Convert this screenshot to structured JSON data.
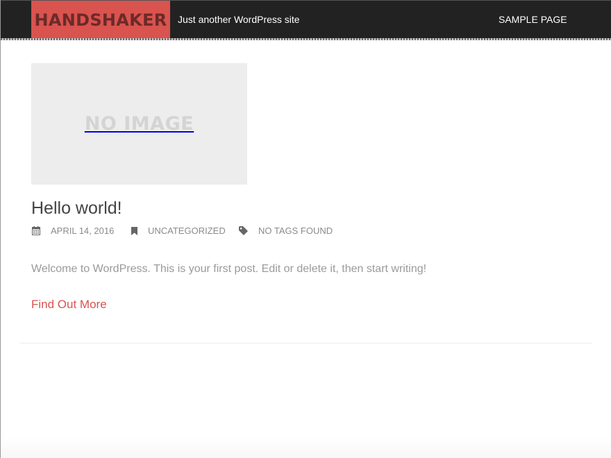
{
  "header": {
    "site_title": "HANDSHAKER",
    "tagline": "Just another WordPress site",
    "nav": [
      {
        "label": "SAMPLE PAGE"
      }
    ]
  },
  "post": {
    "thumbnail_text": "NO IMAGE",
    "title": "Hello world!",
    "meta": {
      "date": "APRIL 14, 2016",
      "category": "UNCATEGORIZED",
      "tags": "NO TAGS FOUND"
    },
    "excerpt": "Welcome to WordPress. This is your first post. Edit or delete it, then start writing!",
    "read_more": "Find Out More"
  },
  "icons": {
    "date": "calendar-icon",
    "category": "bookmark-icon",
    "tags": "tag-icon"
  },
  "colors": {
    "accent": "#d9534f",
    "header_bg": "#222222",
    "logo_text": "#6b2a28"
  }
}
